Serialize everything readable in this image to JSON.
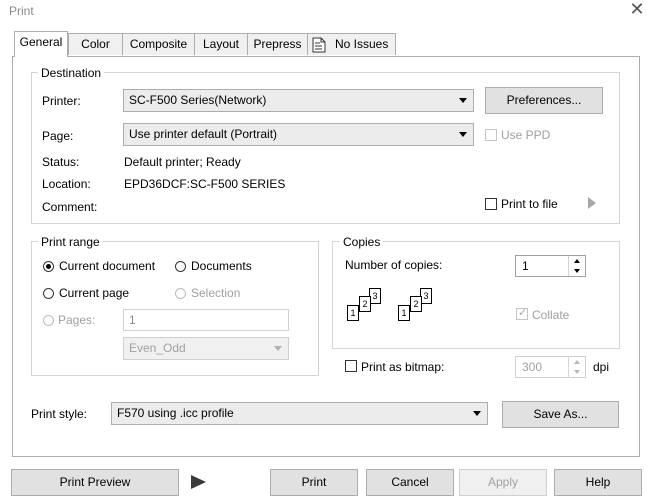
{
  "window": {
    "title": "Print",
    "close_glyph": "✕"
  },
  "tabs": [
    {
      "label": "General",
      "active": true
    },
    {
      "label": "Color"
    },
    {
      "label": "Composite"
    },
    {
      "label": "Layout"
    },
    {
      "label": "Prepress"
    },
    {
      "label": "No Issues",
      "icon": "issues-document-icon"
    }
  ],
  "destination": {
    "legend": "Destination",
    "printer_label": "Printer:",
    "printer_value": "SC-F500 Series(Network)",
    "preferences_button": "Preferences...",
    "page_label": "Page:",
    "page_value": "Use printer default (Portrait)",
    "use_ppd_label": "Use PPD",
    "status_label": "Status:",
    "status_value": "Default printer; Ready",
    "location_label": "Location:",
    "location_value": "EPD36DCF:SC-F500 SERIES",
    "comment_label": "Comment:",
    "print_to_file_label": "Print to file"
  },
  "print_range": {
    "legend": "Print range",
    "current_document": "Current document",
    "documents": "Documents",
    "current_page": "Current page",
    "selection": "Selection",
    "pages_label": "Pages:",
    "pages_value": "1",
    "even_odd_value": "Even_Odd"
  },
  "copies": {
    "legend": "Copies",
    "number_label": "Number of copies:",
    "number_value": "1",
    "collate_label": "Collate",
    "collate_checked": true
  },
  "bitmap": {
    "label": "Print as bitmap:",
    "dpi_value": "300",
    "dpi_unit": "dpi"
  },
  "print_style": {
    "label": "Print style:",
    "value": "F570 using .icc profile",
    "save_as_button": "Save As..."
  },
  "footer": {
    "print_preview": "Print Preview",
    "print": "Print",
    "cancel": "Cancel",
    "apply": "Apply",
    "help": "Help"
  }
}
